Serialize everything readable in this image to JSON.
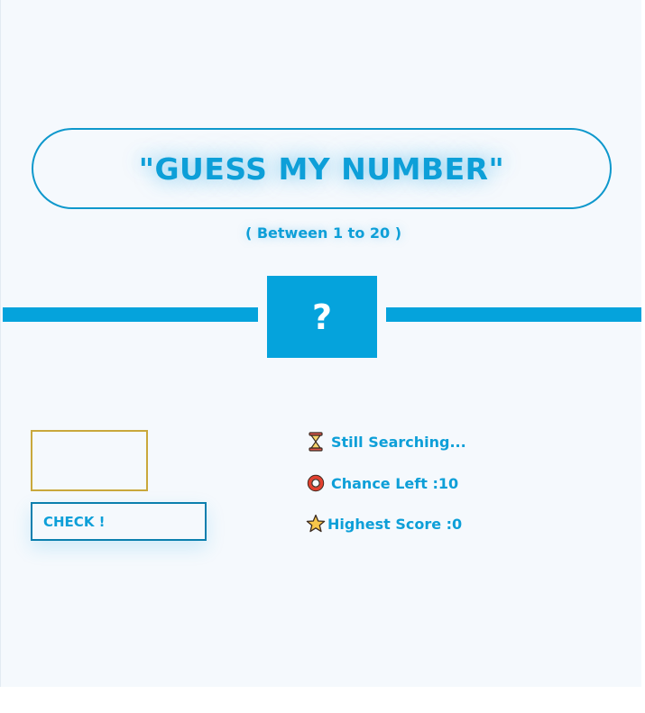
{
  "header": {
    "title": "\"GUESS MY NUMBER\"",
    "subtitle": "( Between 1 to 20 )"
  },
  "secret": {
    "display": "?"
  },
  "guess_input": {
    "value": "",
    "placeholder": ""
  },
  "check_button": {
    "label": "CHECK !"
  },
  "status": {
    "message_icon": "hourglass-icon",
    "message": "Still Searching...",
    "chance_icon": "ring-icon",
    "chance_label": "Chance Left : ",
    "chance_value": "10",
    "highscore_icon": "star-icon",
    "highscore_label": "Highest Score : ",
    "highscore_value": "0"
  },
  "colors": {
    "accent": "#05a3dc",
    "text": "#0d9fd8",
    "background": "#f5f9fd",
    "input_border": "#c9a83c"
  }
}
